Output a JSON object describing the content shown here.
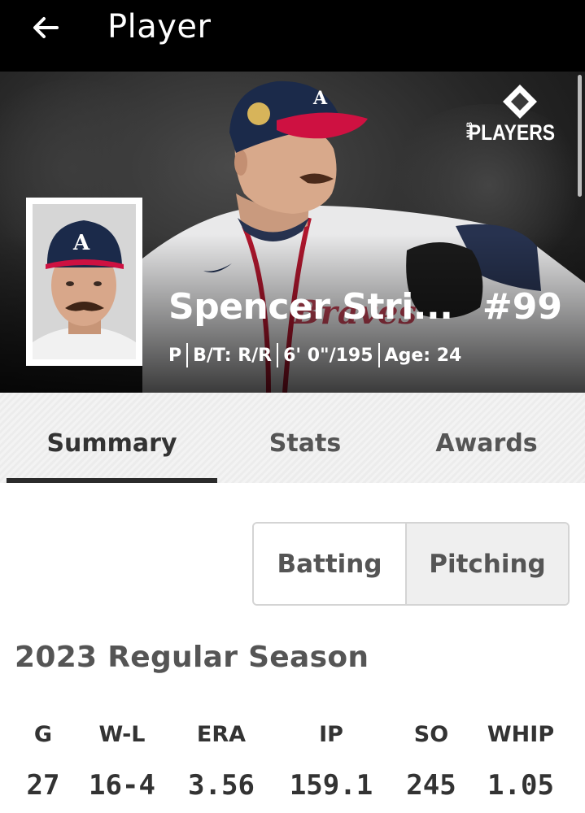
{
  "header": {
    "title": "Player"
  },
  "brand": {
    "logo_text": "PLAYERS",
    "logo_sub": "MLB"
  },
  "player": {
    "name": "Spencer Stri...",
    "number": "#99",
    "position": "P",
    "bats_throws": "B/T: R/R",
    "height_weight": "6' 0\"/195",
    "age": "Age: 24"
  },
  "tabs": [
    {
      "label": "Summary",
      "active": true
    },
    {
      "label": "Stats",
      "active": false
    },
    {
      "label": "Awards",
      "active": false
    }
  ],
  "segment": [
    {
      "label": "Batting",
      "selected": false
    },
    {
      "label": "Pitching",
      "selected": true
    }
  ],
  "season": {
    "title": "2023 Regular Season"
  },
  "stats": {
    "headers": [
      "G",
      "W-L",
      "ERA",
      "IP",
      "SO",
      "WHIP"
    ],
    "values": [
      "27",
      "16-4",
      "3.56",
      "159.1",
      "245",
      "1.05"
    ]
  },
  "colors": {
    "topbar": "#000000",
    "cap_navy": "#1b2a4a",
    "cap_red": "#ce1141",
    "tab_active_underline": "#2b2b2b"
  }
}
